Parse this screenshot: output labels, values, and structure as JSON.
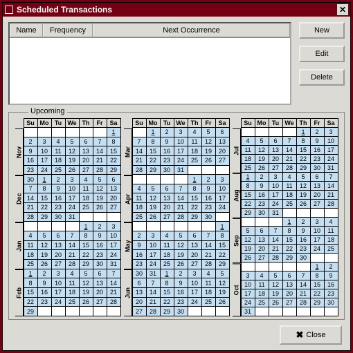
{
  "window": {
    "title": "Scheduled Transactions"
  },
  "list": {
    "columns": {
      "name": "Name",
      "frequency": "Frequency",
      "next": "Next Occurrence"
    }
  },
  "buttons": {
    "new": "New",
    "edit": "Edit",
    "delete": "Delete",
    "close": "Close"
  },
  "upcoming": {
    "label": "Upcoming",
    "weekdays": [
      "Su",
      "Mo",
      "Tu",
      "We",
      "Th",
      "Fr",
      "Sa"
    ],
    "columns": [
      {
        "months": [
          {
            "name": "Nov",
            "rows": [
              [
                "",
                "",
                "",
                "",
                "",
                "",
                "1"
              ],
              [
                "2",
                "3",
                "4",
                "5",
                "6",
                "7",
                "8"
              ],
              [
                "9",
                "10",
                "11",
                "12",
                "13",
                "14",
                "15"
              ],
              [
                "16",
                "17",
                "18",
                "19",
                "20",
                "21",
                "22"
              ],
              [
                "23",
                "24",
                "25",
                "26",
                "27",
                "28",
                "29"
              ]
            ]
          },
          {
            "name": "Dec",
            "rows": [
              [
                "30",
                "1",
                "2",
                "3",
                "4",
                "5",
                "6"
              ],
              [
                "7",
                "8",
                "9",
                "10",
                "11",
                "12",
                "13"
              ],
              [
                "14",
                "15",
                "16",
                "17",
                "18",
                "19",
                "20"
              ],
              [
                "21",
                "22",
                "23",
                "24",
                "25",
                "26",
                "27"
              ],
              [
                "28",
                "29",
                "30",
                "31",
                "",
                "",
                ""
              ]
            ]
          },
          {
            "name": "Jan",
            "rows": [
              [
                "",
                "",
                "",
                "",
                "1",
                "2",
                "3"
              ],
              [
                "4",
                "5",
                "6",
                "7",
                "8",
                "9",
                "10"
              ],
              [
                "11",
                "12",
                "13",
                "14",
                "15",
                "16",
                "17"
              ],
              [
                "18",
                "19",
                "20",
                "21",
                "22",
                "23",
                "24"
              ],
              [
                "25",
                "26",
                "27",
                "28",
                "29",
                "30",
                "31"
              ]
            ]
          },
          {
            "name": "Feb",
            "rows": [
              [
                "1",
                "2",
                "3",
                "4",
                "5",
                "6",
                "7"
              ],
              [
                "8",
                "9",
                "10",
                "11",
                "12",
                "13",
                "14"
              ],
              [
                "15",
                "16",
                "17",
                "18",
                "19",
                "20",
                "21"
              ],
              [
                "22",
                "23",
                "24",
                "25",
                "26",
                "27",
                "28"
              ],
              [
                "29",
                "",
                "",
                "",
                "",
                "",
                ""
              ]
            ]
          }
        ]
      },
      {
        "months": [
          {
            "name": "Mar",
            "rows": [
              [
                "",
                "1",
                "2",
                "3",
                "4",
                "5",
                "6"
              ],
              [
                "7",
                "8",
                "9",
                "10",
                "11",
                "12",
                "13"
              ],
              [
                "14",
                "15",
                "16",
                "17",
                "18",
                "19",
                "20"
              ],
              [
                "21",
                "22",
                "23",
                "24",
                "25",
                "26",
                "27"
              ],
              [
                "28",
                "29",
                "30",
                "31",
                "",
                "",
                ""
              ]
            ]
          },
          {
            "name": "Apr",
            "rows": [
              [
                "",
                "",
                "",
                "",
                "1",
                "2",
                "3"
              ],
              [
                "4",
                "5",
                "6",
                "7",
                "8",
                "9",
                "10"
              ],
              [
                "11",
                "12",
                "13",
                "14",
                "15",
                "16",
                "17"
              ],
              [
                "18",
                "19",
                "20",
                "21",
                "22",
                "23",
                "24"
              ],
              [
                "25",
                "26",
                "27",
                "28",
                "29",
                "30",
                ""
              ]
            ]
          },
          {
            "name": "May",
            "rows": [
              [
                "",
                "",
                "",
                "",
                "",
                "",
                "1"
              ],
              [
                "2",
                "3",
                "4",
                "5",
                "6",
                "7",
                "8"
              ],
              [
                "9",
                "10",
                "11",
                "12",
                "13",
                "14",
                "15"
              ],
              [
                "16",
                "17",
                "18",
                "19",
                "20",
                "21",
                "22"
              ],
              [
                "23",
                "24",
                "25",
                "26",
                "27",
                "28",
                "29"
              ]
            ]
          },
          {
            "name": "Jun",
            "rows": [
              [
                "30",
                "31",
                "1",
                "2",
                "3",
                "4",
                "5"
              ],
              [
                "6",
                "7",
                "8",
                "9",
                "10",
                "11",
                "12"
              ],
              [
                "13",
                "14",
                "15",
                "16",
                "17",
                "18",
                "19"
              ],
              [
                "20",
                "21",
                "22",
                "23",
                "24",
                "25",
                "26"
              ],
              [
                "27",
                "28",
                "29",
                "30",
                "",
                "",
                ""
              ]
            ]
          }
        ]
      },
      {
        "months": [
          {
            "name": "Jul",
            "rows": [
              [
                "",
                "",
                "",
                "",
                "1",
                "2",
                "3"
              ],
              [
                "4",
                "5",
                "6",
                "7",
                "8",
                "9",
                "10"
              ],
              [
                "11",
                "12",
                "13",
                "14",
                "15",
                "16",
                "17"
              ],
              [
                "18",
                "19",
                "20",
                "21",
                "22",
                "23",
                "24"
              ],
              [
                "25",
                "26",
                "27",
                "28",
                "29",
                "30",
                "31"
              ]
            ]
          },
          {
            "name": "Aug",
            "rows": [
              [
                "1",
                "2",
                "3",
                "4",
                "5",
                "6",
                "7"
              ],
              [
                "8",
                "9",
                "10",
                "11",
                "12",
                "13",
                "14"
              ],
              [
                "15",
                "16",
                "17",
                "18",
                "19",
                "20",
                "21"
              ],
              [
                "22",
                "23",
                "24",
                "25",
                "26",
                "27",
                "28"
              ],
              [
                "29",
                "30",
                "31",
                "",
                "",
                "",
                ""
              ]
            ]
          },
          {
            "name": "Sep",
            "rows": [
              [
                "",
                "",
                "",
                "1",
                "2",
                "3",
                "4"
              ],
              [
                "5",
                "6",
                "7",
                "8",
                "9",
                "10",
                "11"
              ],
              [
                "12",
                "13",
                "14",
                "15",
                "16",
                "17",
                "18"
              ],
              [
                "19",
                "20",
                "21",
                "22",
                "23",
                "24",
                "25"
              ],
              [
                "26",
                "27",
                "28",
                "29",
                "30",
                "",
                ""
              ]
            ]
          },
          {
            "name": "Oct",
            "rows": [
              [
                "",
                "",
                "",
                "",
                "",
                "1",
                "2"
              ],
              [
                "3",
                "4",
                "5",
                "6",
                "7",
                "8",
                "9"
              ],
              [
                "10",
                "11",
                "12",
                "13",
                "14",
                "15",
                "16"
              ],
              [
                "17",
                "18",
                "19",
                "20",
                "21",
                "22",
                "23"
              ],
              [
                "24",
                "25",
                "26",
                "27",
                "28",
                "29",
                "30"
              ],
              [
                "31",
                "",
                "",
                "",
                "",
                "",
                ""
              ]
            ]
          }
        ]
      }
    ]
  }
}
